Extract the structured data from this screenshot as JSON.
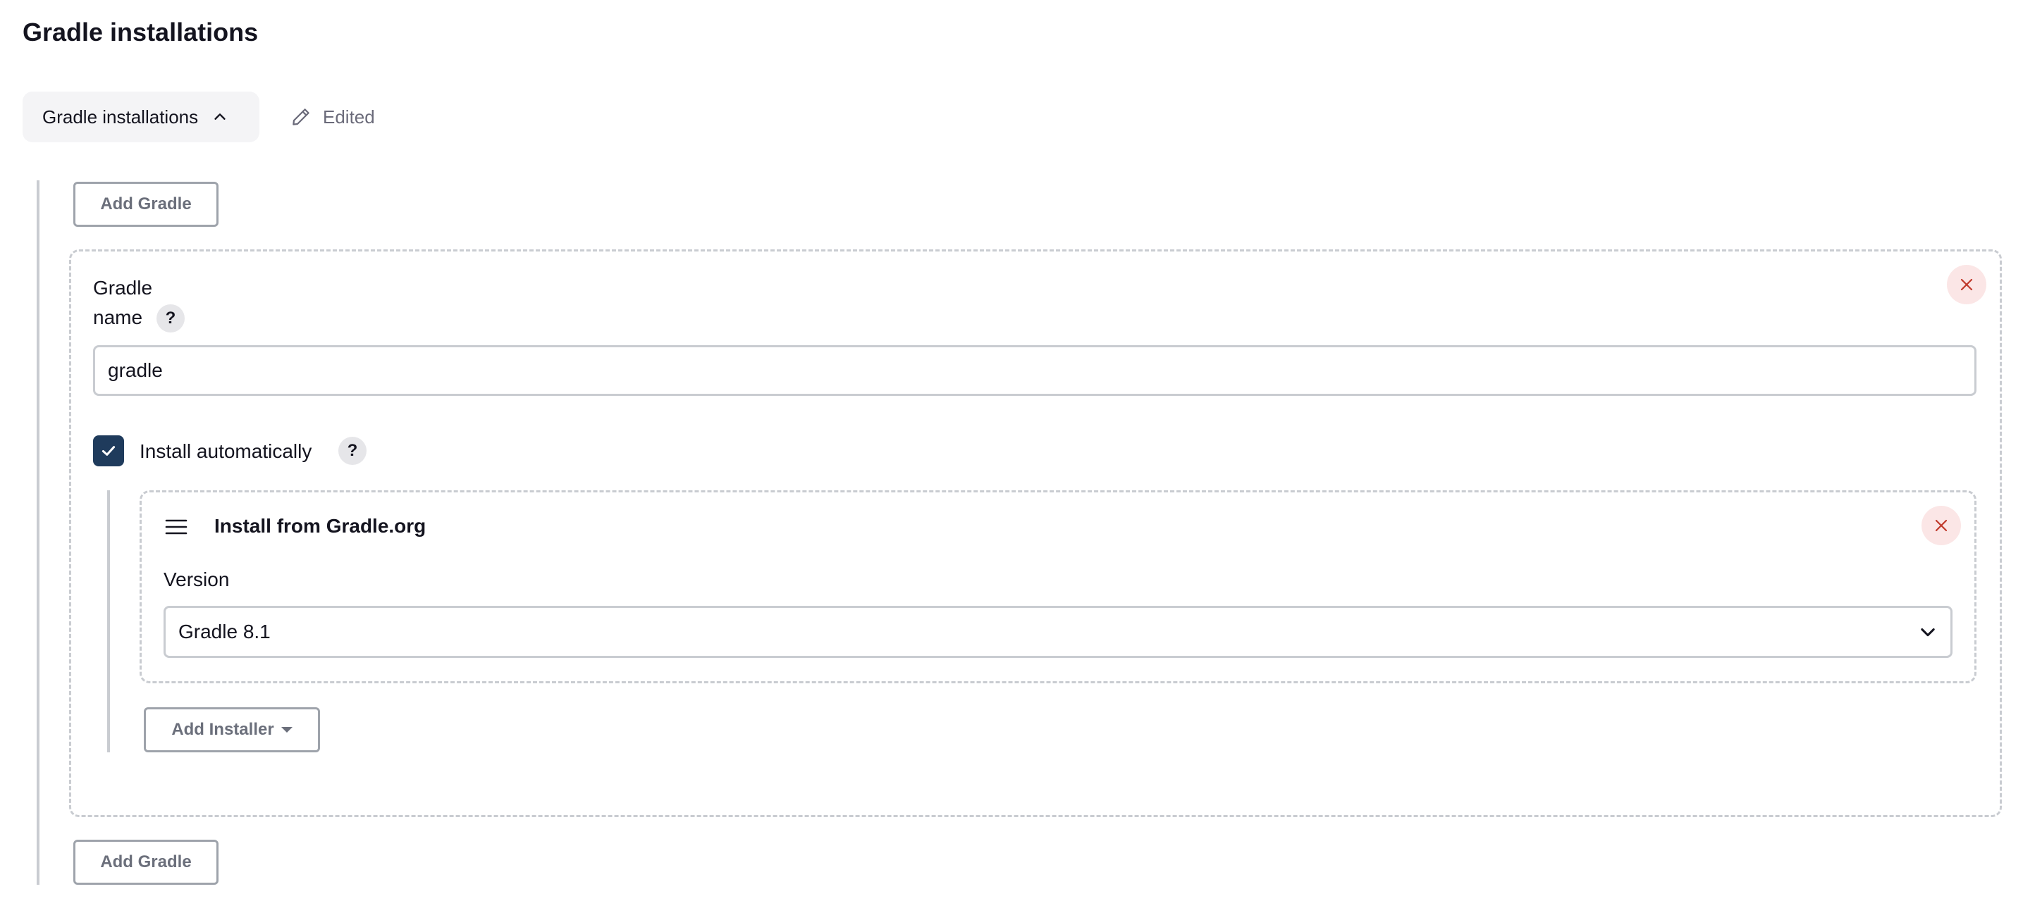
{
  "page": {
    "title": "Gradle installations"
  },
  "section": {
    "toggle_label": "Gradle installations",
    "toggle_icon": "chevron-up-icon",
    "status_icon": "pencil-icon",
    "status_text": "Edited"
  },
  "buttons": {
    "add_gradle": "Add Gradle",
    "add_installer": "Add Installer"
  },
  "installation": {
    "name_label_line1": "Gradle",
    "name_label_line2": "name",
    "name_help": "?",
    "name_value": "gradle",
    "install_auto_label": "Install automatically",
    "install_auto_checked": true,
    "install_auto_help": "?",
    "installer": {
      "title": "Install from Gradle.org",
      "version_label": "Version",
      "version_selected": "Gradle 8.1"
    }
  },
  "colors": {
    "checkbox": "#1f3b5c",
    "close_bg": "#fbe6e6",
    "close_icon": "#c0392b",
    "border": "#c9ccd1"
  }
}
